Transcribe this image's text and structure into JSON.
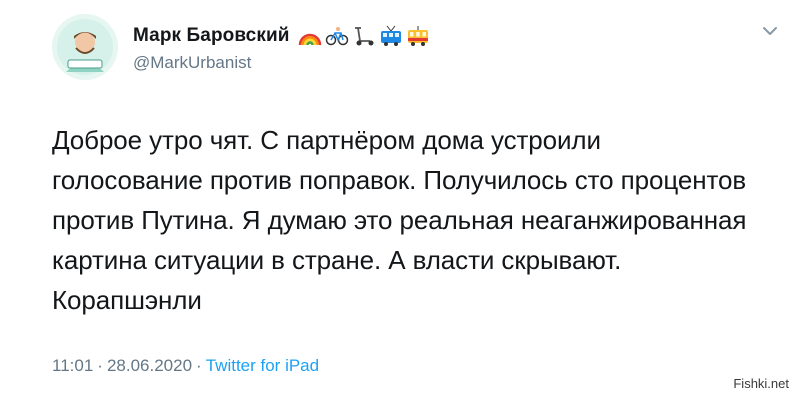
{
  "user": {
    "display_name": "Марк Баровский",
    "handle": "@MarkUrbanist",
    "name_emojis": [
      "rainbow-icon",
      "bicycle-icon",
      "scooter-icon",
      "trolleybus-icon",
      "tram-icon"
    ]
  },
  "tweet": {
    "text": "Доброе утро чят. С партнёром дома устроили\nголосование против поправок. Получилось сто процентов\nпротив Путина. Я думаю это реальная неаганжированная\nкартина ситуации в стране. А власти скрывают.\nКорапшэнли",
    "time": "11:01",
    "date": "28.06.2020",
    "separator": "·",
    "source": "Twitter for iPad"
  },
  "watermark": "Fishki.net",
  "colors": {
    "text": "#14171a",
    "secondary": "#657786",
    "link": "#1da1f2"
  }
}
